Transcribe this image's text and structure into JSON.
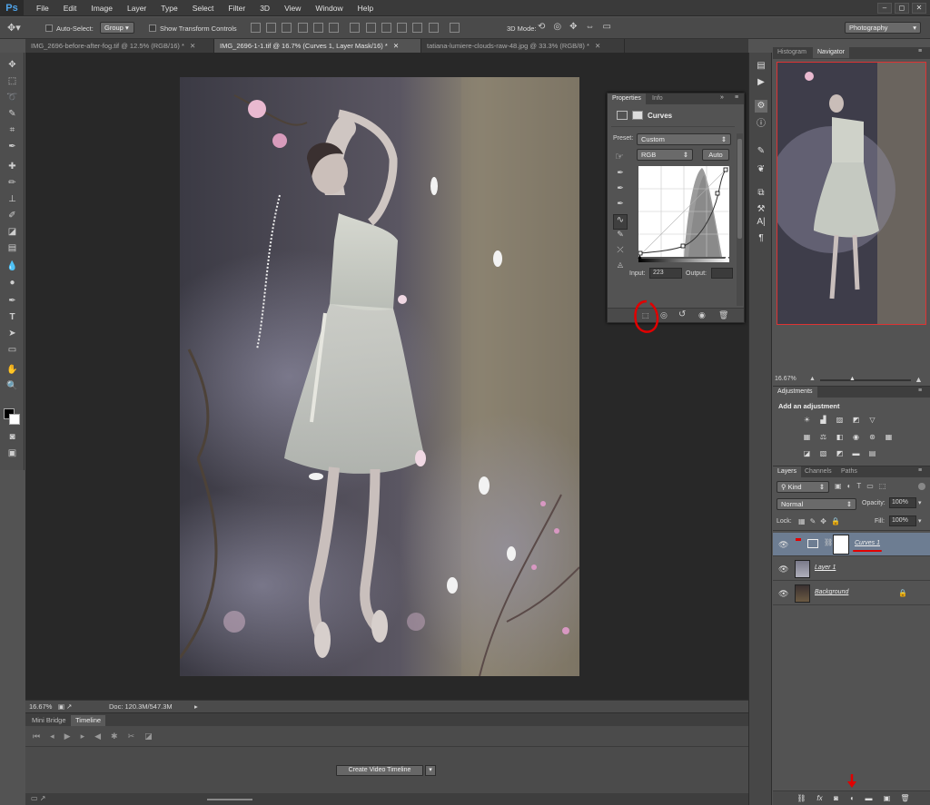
{
  "app": {
    "logo": "Ps"
  },
  "menu": [
    "File",
    "Edit",
    "Image",
    "Layer",
    "Type",
    "Select",
    "Filter",
    "3D",
    "View",
    "Window",
    "Help"
  ],
  "window_controls": {
    "minimize": "–",
    "maximize": "◻",
    "close": "✕"
  },
  "options_bar": {
    "auto_select_label": "Auto-Select:",
    "auto_select_value": "Group",
    "show_transform_label": "Show Transform Controls",
    "mode_label": "3D Mode:",
    "workspace": "Photography"
  },
  "doc_tabs": [
    {
      "label": "IMG_2696-before-after-fog.tif @ 12.5% (RGB/16) *"
    },
    {
      "label": "IMG_2696-1-1.tif @ 16.7% (Curves 1, Layer Mask/16) *"
    },
    {
      "label": "tatiana-lumiere-clouds-raw-48.jpg @ 33.3% (RGB/8) *"
    }
  ],
  "tab_close": "✕",
  "statusbar": {
    "zoom": "16.67%",
    "doc": "Doc: 120.3M/547.3M"
  },
  "timeline": {
    "tabs": [
      "Mini Bridge",
      "Timeline"
    ],
    "create_button": "Create Video Timeline"
  },
  "properties": {
    "tabs": [
      "Properties",
      "Info"
    ],
    "title": "Curves",
    "preset_label": "Preset:",
    "preset_value": "Custom",
    "channel_value": "RGB",
    "auto_button": "Auto",
    "input_label": "Input:",
    "input_value": "223",
    "output_label": "Output:",
    "output_value": ""
  },
  "navigator": {
    "tabs": [
      "Histogram",
      "Navigator"
    ],
    "zoom": "16.67%"
  },
  "adjustments": {
    "tab": "Adjustments",
    "heading": "Add an adjustment"
  },
  "layers": {
    "tabs": [
      "Layers",
      "Channels",
      "Paths"
    ],
    "filter_kind": "Kind",
    "blend_mode": "Normal",
    "opacity_label": "Opacity:",
    "opacity_value": "100%",
    "lock_label": "Lock:",
    "fill_label": "Fill:",
    "fill_value": "100%",
    "rows": [
      {
        "name": "Curves 1",
        "selected": true
      },
      {
        "name": "Layer 1",
        "selected": false
      },
      {
        "name": "Background",
        "selected": false
      }
    ]
  },
  "colors": {
    "accent_selected_layer": "#6d7d92",
    "annotation_red": "#e10000",
    "navigator_frame": "#dd3333"
  }
}
